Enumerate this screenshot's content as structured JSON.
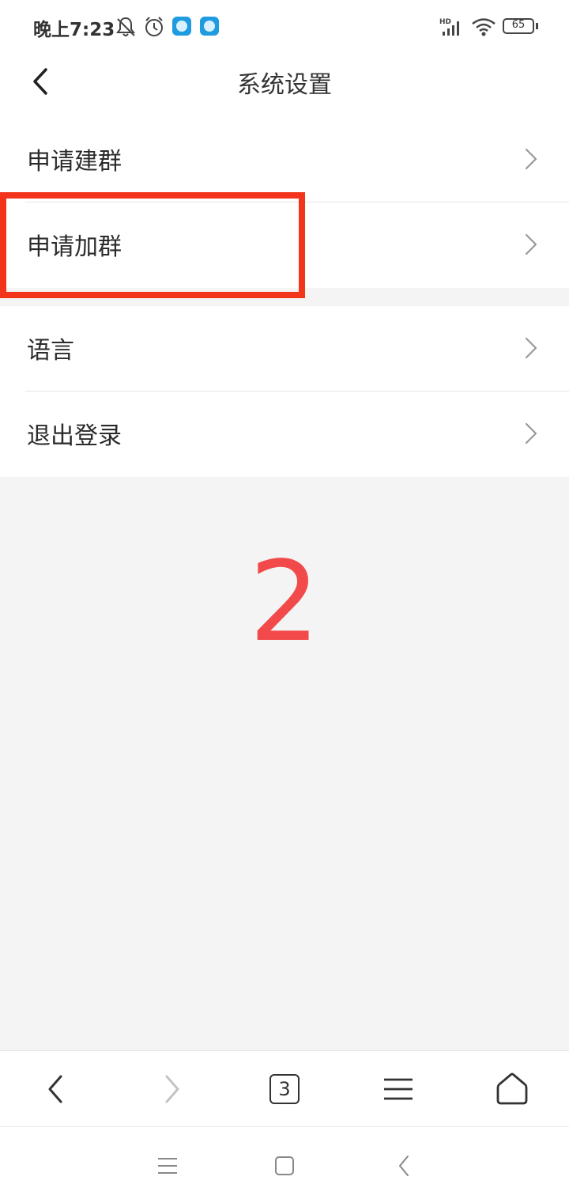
{
  "status": {
    "time": "晚上7:23",
    "battery": "65",
    "network": "HD"
  },
  "header": {
    "title": "系统设置"
  },
  "settings": {
    "group1": [
      {
        "label": "申请建群"
      },
      {
        "label": "申请加群"
      }
    ],
    "group2": [
      {
        "label": "语言"
      },
      {
        "label": "退出登录"
      }
    ]
  },
  "annotation": {
    "number": "2",
    "color": "#f24a4a",
    "box_color": "#f2341a"
  },
  "browser_nav": {
    "tab_count": "3"
  }
}
